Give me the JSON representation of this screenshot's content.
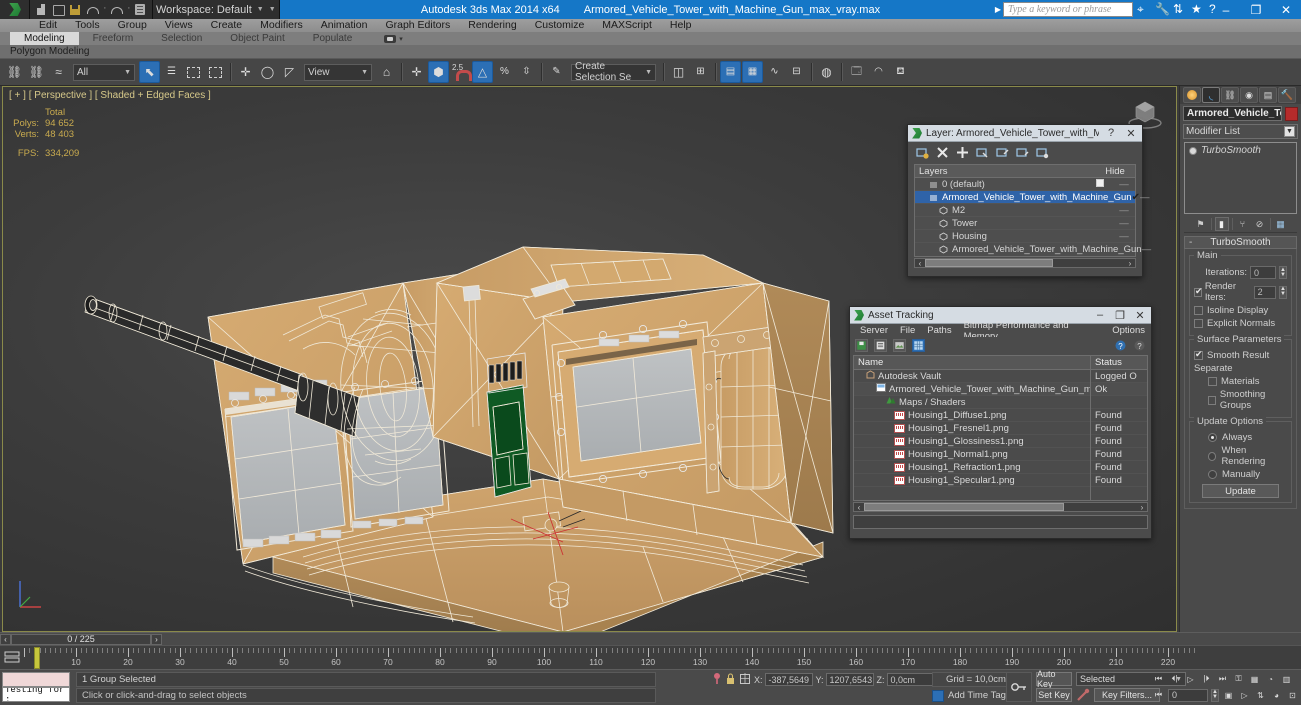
{
  "titlebar": {
    "app_title": "Autodesk 3ds Max  2014 x64",
    "file_title": "Armored_Vehicle_Tower_with_Machine_Gun_max_vray.max",
    "workspace_label": "Workspace: Default",
    "search_placeholder": "Type a keyword or phrase",
    "minimize": "–",
    "maximize": "❐",
    "close": "✕"
  },
  "menubar": {
    "items": [
      "Edit",
      "Tools",
      "Group",
      "Views",
      "Create",
      "Modifiers",
      "Animation",
      "Graph Editors",
      "Rendering",
      "Customize",
      "MAXScript",
      "Help"
    ]
  },
  "ribbon": {
    "tabs": [
      "Modeling",
      "Freeform",
      "Selection",
      "Object Paint",
      "Populate"
    ],
    "active_tab": "Modeling",
    "subtitle": "Polygon Modeling"
  },
  "toolbar": {
    "selection_filter": "All",
    "reference_coord": "View",
    "named_selection_sets": "Create Selection Se",
    "snap_percent": "2.5"
  },
  "viewport": {
    "label": "[ + ] [ Perspective ] [ Shaded + Edged Faces ]",
    "stats_header": "Total",
    "stats": [
      {
        "label": "Polys:",
        "value": "94 652"
      },
      {
        "label": "Verts:",
        "value": "48 403"
      }
    ],
    "fps_label": "FPS:",
    "fps_value": "334,209"
  },
  "command_panel": {
    "object_name": "Armored_Vehicle_Tower",
    "object_color": "#b52b2b",
    "modifier_list_label": "Modifier List",
    "modifier_stack": [
      "TurboSmooth"
    ],
    "rollouts": [
      {
        "title": "TurboSmooth",
        "groups": [
          {
            "title": "Main",
            "fields": [
              {
                "type": "spinner",
                "label": "Iterations:",
                "value": "0"
              },
              {
                "type": "check-spinner",
                "label": "Render Iters:",
                "value": "2",
                "checked": true
              },
              {
                "type": "checkbox",
                "label": "Isoline Display",
                "checked": false
              },
              {
                "type": "checkbox",
                "label": "Explicit Normals",
                "checked": false
              }
            ]
          },
          {
            "title": "Surface Parameters",
            "fields": [
              {
                "type": "checkbox",
                "label": "Smooth Result",
                "checked": true
              },
              {
                "type": "sublabel",
                "label": "Separate"
              },
              {
                "type": "checkbox-indent",
                "label": "Materials",
                "checked": false
              },
              {
                "type": "checkbox-indent",
                "label": "Smoothing Groups",
                "checked": false
              }
            ]
          },
          {
            "title": "Update Options",
            "fields": [
              {
                "type": "radio",
                "label": "Always",
                "selected": true
              },
              {
                "type": "radio",
                "label": "When Rendering",
                "selected": false
              },
              {
                "type": "radio",
                "label": "Manually",
                "selected": false
              },
              {
                "type": "button",
                "label": "Update"
              }
            ]
          }
        ]
      }
    ]
  },
  "layer_dialog": {
    "title": "Layer: Armored_Vehicle_Tower_with_Mac...",
    "help_btn": "?",
    "close_btn": "✕",
    "col_name": "Layers",
    "col_hide": "Hide",
    "rows": [
      {
        "name": "0 (default)",
        "indent": 0,
        "selected": false,
        "hide_box": true,
        "check": false
      },
      {
        "name": "Armored_Vehicle_Tower_with_Machine_Gun",
        "indent": 0,
        "selected": true,
        "hide_box": false,
        "check": true
      },
      {
        "name": "M2",
        "indent": 1,
        "selected": false,
        "hide_box": false,
        "check": false
      },
      {
        "name": "Tower",
        "indent": 1,
        "selected": false,
        "hide_box": false,
        "check": false
      },
      {
        "name": "Housing",
        "indent": 1,
        "selected": false,
        "hide_box": false,
        "check": false
      },
      {
        "name": "Armored_Vehicle_Tower_with_Machine_Gun",
        "indent": 1,
        "selected": false,
        "hide_box": false,
        "check": false
      }
    ]
  },
  "asset_tracking": {
    "title": "Asset Tracking",
    "minimize": "–",
    "maximize": "❐",
    "close": "✕",
    "menu": [
      "Server",
      "File",
      "Paths",
      "Bitmap Performance and Memory",
      "Options"
    ],
    "col_name": "Name",
    "col_status": "Status",
    "rows": [
      {
        "name": "Autodesk Vault",
        "status": "Logged O",
        "indent": 0,
        "icon": "vault-icon"
      },
      {
        "name": "Armored_Vehicle_Tower_with_Machine_Gun_max_vray.max",
        "status": "Ok",
        "indent": 1,
        "icon": "max-file-icon"
      },
      {
        "name": "Maps / Shaders",
        "status": "",
        "indent": 2,
        "icon": "maps-icon"
      },
      {
        "name": "Housing1_Diffuse1.png",
        "status": "Found",
        "indent": 3,
        "icon": "png-icon"
      },
      {
        "name": "Housing1_Fresnel1.png",
        "status": "Found",
        "indent": 3,
        "icon": "png-icon"
      },
      {
        "name": "Housing1_Glossiness1.png",
        "status": "Found",
        "indent": 3,
        "icon": "png-icon"
      },
      {
        "name": "Housing1_Normal1.png",
        "status": "Found",
        "indent": 3,
        "icon": "png-icon"
      },
      {
        "name": "Housing1_Refraction1.png",
        "status": "Found",
        "indent": 3,
        "icon": "png-icon"
      },
      {
        "name": "Housing1_Specular1.png",
        "status": "Found",
        "indent": 3,
        "icon": "png-icon"
      }
    ]
  },
  "timeline": {
    "frame_field": "0 / 225",
    "prev_arrow": "‹",
    "next_arrow": "›",
    "tick_labels": [
      10,
      20,
      30,
      40,
      50,
      60,
      70,
      80,
      90,
      100,
      110,
      120,
      130,
      140,
      150,
      160,
      170,
      180,
      190,
      200,
      210,
      220
    ],
    "range_end": 225
  },
  "statusbar": {
    "listener_text": "Testing for ;",
    "prompt_line1": "1 Group Selected",
    "prompt_line2": "Click or click-and-drag to select objects",
    "coords": [
      {
        "axis": "X:",
        "value": "-387,5649"
      },
      {
        "axis": "Y:",
        "value": "1207,6543"
      },
      {
        "axis": "Z:",
        "value": "0,0cm"
      }
    ],
    "grid_info": "Grid = 10,0cm",
    "add_time_tag": "Add Time Tag",
    "auto_key": "Auto Key",
    "set_key": "Set Key",
    "selection_set": "Selected",
    "key_filters": "Key Filters...",
    "current_frame": "0"
  }
}
